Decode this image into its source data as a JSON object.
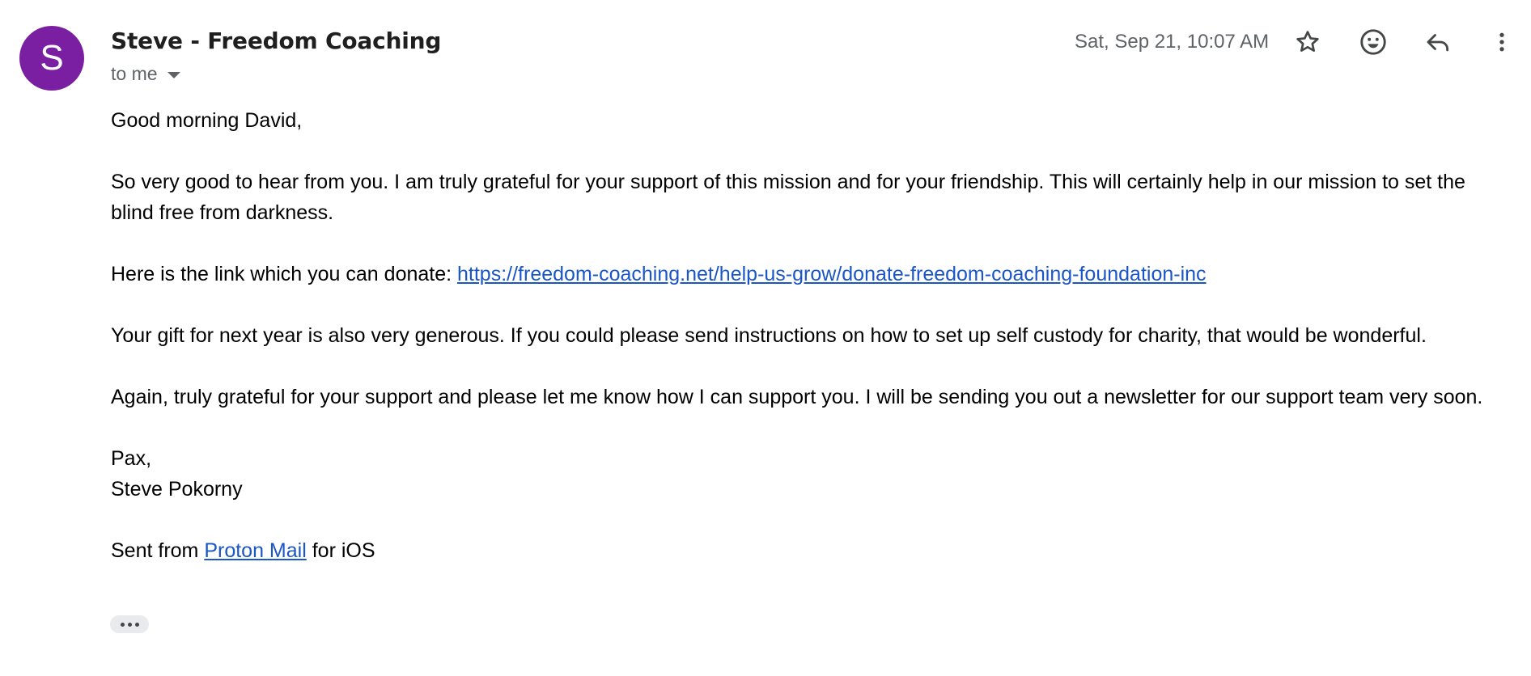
{
  "avatar": {
    "letter": "S",
    "color": "#7b1fa2"
  },
  "header": {
    "sender": "Steve - Freedom Coaching",
    "recipient": "to me",
    "date": "Sat, Sep 21, 10:07 AM",
    "icons": [
      "star-icon",
      "emoji-reaction-icon",
      "reply-icon",
      "more-vert-icon"
    ]
  },
  "body": {
    "greeting": "Good morning David,",
    "para1": "So very good to hear from you. I am truly grateful for your support of this mission and for your friendship. This will certainly help in our mission to set the blind free from darkness.",
    "para2_prefix": "Here is the link which you can donate: ",
    "donate_link": "https://freedom-coaching.net/help-us-grow/donate-freedom-coaching-foundation-inc",
    "para3": "Your gift for next year is also very generous. If you could please send instructions on how to set up self custody for charity, that would be wonderful.",
    "para4": "Again, truly grateful for your support and please let me know how I can support you. I will be sending you out a newsletter for our support team very soon.",
    "signoff": "Pax,",
    "signature_name": "Steve Pokorny",
    "sent_prefix": "Sent from ",
    "sent_link": "Proton Mail",
    "sent_suffix": " for iOS"
  },
  "colors": {
    "link": "#1a56c8",
    "muted": "#5f6368"
  }
}
